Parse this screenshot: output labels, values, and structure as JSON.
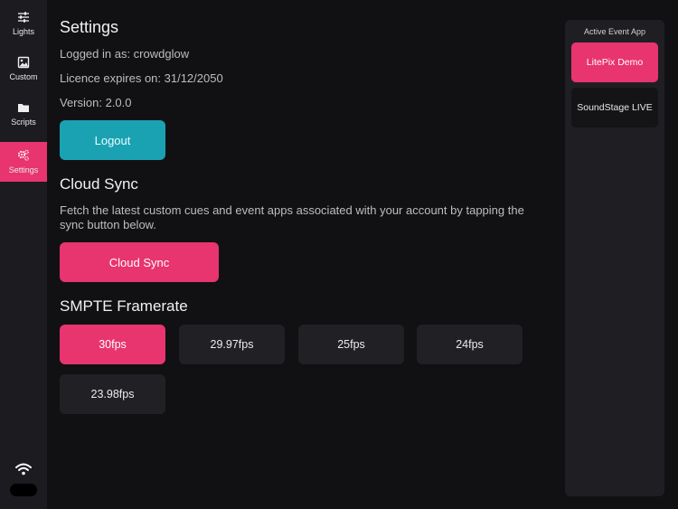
{
  "sidebar": {
    "items": [
      {
        "label": "Lights",
        "icon": "sliders-icon"
      },
      {
        "label": "Custom",
        "icon": "image-icon"
      },
      {
        "label": "Scripts",
        "icon": "folder-icon"
      },
      {
        "label": "Settings",
        "icon": "gears-icon"
      }
    ],
    "active": "Settings"
  },
  "settings": {
    "title": "Settings",
    "logged_in": "Logged in as: crowdglow",
    "licence": "Licence expires on: 31/12/2050",
    "version": "Version: 2.0.0",
    "logout_label": "Logout"
  },
  "cloud_sync": {
    "title": "Cloud Sync",
    "description": "Fetch the latest custom cues and event apps associated with your account by tapping the sync button below.",
    "button_label": "Cloud Sync"
  },
  "smpte": {
    "title": "SMPTE Framerate",
    "options": [
      "30fps",
      "29.97fps",
      "25fps",
      "24fps",
      "23.98fps"
    ],
    "selected": "30fps"
  },
  "event_panel": {
    "title": "Active Event App",
    "apps": [
      "LitePix Demo",
      "SoundStage LIVE"
    ],
    "active": "LitePix Demo"
  },
  "colors": {
    "accent": "#e8346f",
    "logout": "#1aa2b2",
    "background": "#111113"
  }
}
